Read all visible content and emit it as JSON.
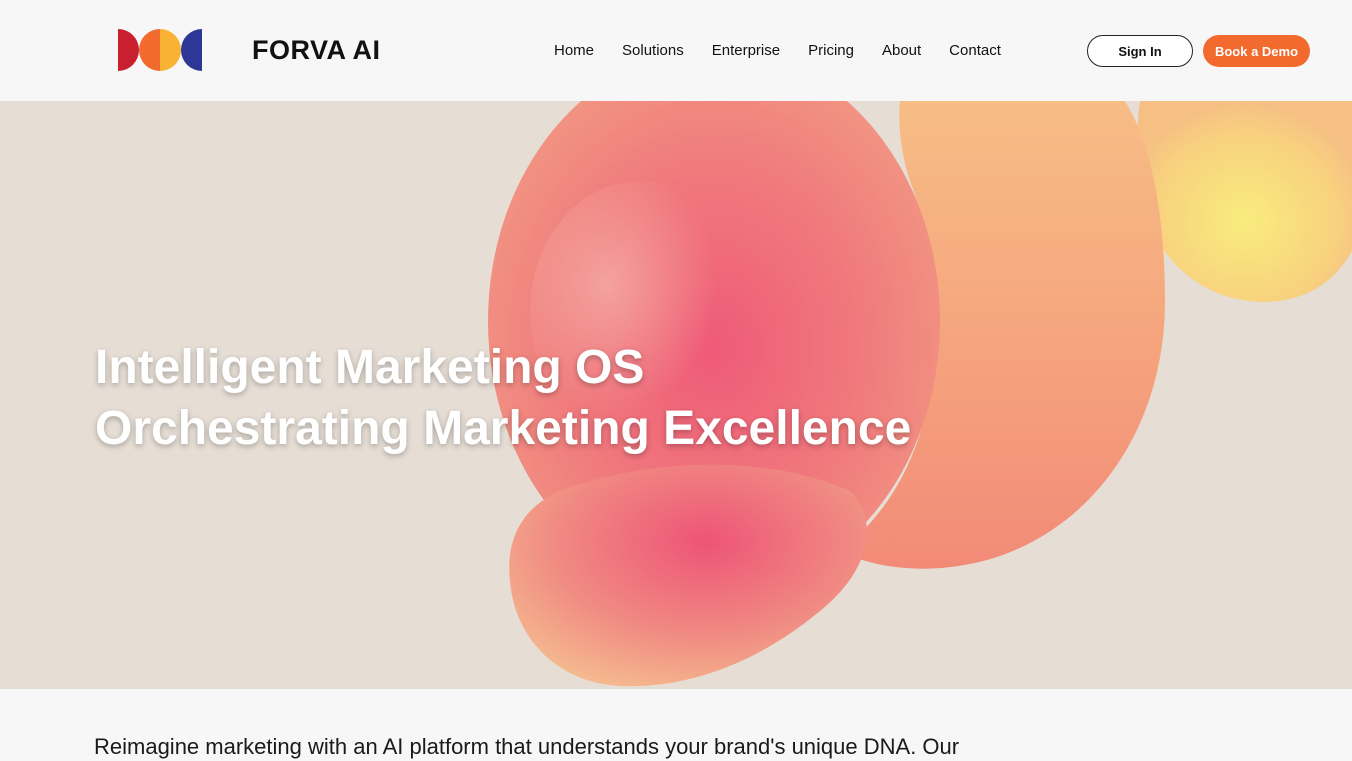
{
  "header": {
    "brand": "FORVA AI",
    "nav": [
      "Home",
      "Solutions",
      "Enterprise",
      "Pricing",
      "About",
      "Contact"
    ],
    "sign_in": "Sign In",
    "book_demo": "Book a Demo"
  },
  "hero": {
    "title_line1": "Intelligent Marketing OS",
    "title_line2": "Orchestrating Marketing Excellence"
  },
  "intro": {
    "text": "Reimagine marketing with an AI platform that understands your brand's unique DNA. Our"
  },
  "colors": {
    "accent": "#f26a2d",
    "logo_red": "#c8202f",
    "logo_orange": "#f26a2d",
    "logo_yellow": "#f9b233",
    "logo_blue": "#2f3796",
    "hero_bg": "#e6ded5"
  },
  "icons": {
    "logo": "semicircle-logo-icon"
  }
}
